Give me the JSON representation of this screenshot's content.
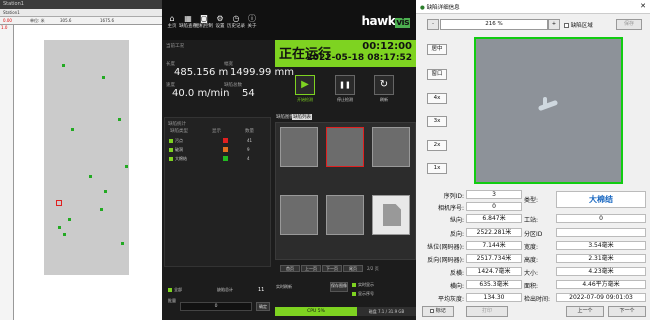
{
  "map": {
    "window_title": "Station1",
    "tab": "Station1",
    "header_cols": [
      "0.00",
      "单位: 米",
      "305.6",
      "1675.6"
    ],
    "ruler_marks": [
      "0.0",
      "",
      "",
      "",
      ""
    ],
    "y_labels": [
      "1.0",
      "",
      "",
      "",
      "",
      "",
      "",
      "",
      ""
    ]
  },
  "nav": {
    "items": [
      {
        "label": "主页",
        "icon": "home-icon",
        "glyph": "⌂"
      },
      {
        "label": "缺陷查看",
        "icon": "grid-icon",
        "glyph": "▦"
      },
      {
        "label": "相机控制",
        "icon": "camera-icon",
        "glyph": "◙"
      },
      {
        "label": "设置",
        "icon": "gear-icon",
        "glyph": "⚙"
      },
      {
        "label": "历史记录",
        "icon": "clock-icon",
        "glyph": "◷"
      },
      {
        "label": "关于",
        "icon": "info-icon",
        "glyph": "ⓘ"
      }
    ],
    "logo_main": "hawk",
    "logo_tag": "vis"
  },
  "info": {
    "section": "当前工况",
    "length_label": "长度",
    "length": "485.156 m",
    "width_label": "幅宽",
    "width": "1499.99 mm",
    "speed_label": "速度",
    "speed": "40.0 m/min",
    "defects_label": "缺陷总数",
    "defects": "54"
  },
  "status": {
    "title": "正在运行",
    "elapsed": "00:12:00",
    "datetime": "2022-05-18 08:17:52"
  },
  "controls": [
    {
      "label": "开始检测",
      "glyph": "▶",
      "icon": "play-icon"
    },
    {
      "label": "停止检测",
      "glyph": "❚❚",
      "icon": "pause-icon"
    },
    {
      "label": "刷新",
      "glyph": "↻",
      "icon": "refresh-icon"
    }
  ],
  "stats": {
    "title": "缺陷统计",
    "headers": [
      "缺陷类型",
      "显示",
      "数量"
    ],
    "rows": [
      {
        "name": "污点",
        "count": "41"
      },
      {
        "name": "破洞",
        "count": "9"
      },
      {
        "name": "大棉结",
        "count": "4"
      }
    ],
    "show_all": "全部",
    "total_label": "缺陷总计",
    "total": "11",
    "name_label": "批量",
    "name_value": "0",
    "confirm": "确定"
  },
  "thumbs": {
    "tabs": [
      "缺陷图像",
      "缺陷列表"
    ],
    "paging": [
      "首页",
      "上一页",
      "下一页",
      "尾页"
    ],
    "page": "2/2 页",
    "auto_refresh": "实时刷新",
    "keep": "保存图像",
    "options": [
      "实时显示",
      "显示序号"
    ],
    "cpu": "CPU 5%",
    "disk": "磁盘 7.1 / 31.9 GB"
  },
  "dialog": {
    "title": "缺陷详细信息",
    "zoom_minus": "-",
    "zoom": "216 %",
    "zoom_plus": "+",
    "area_check": "缺陷区域",
    "save": "保存",
    "zoom_buttons": [
      "居中",
      "窗口",
      "4x",
      "3x",
      "2x",
      "1x"
    ],
    "fields_left": [
      {
        "label": "序列ID:",
        "value": "3"
      },
      {
        "label": "相机序号:",
        "value": "0"
      },
      {
        "label": "纵向:",
        "value": "6.847米"
      },
      {
        "label": "反向:",
        "value": "2522.281米"
      },
      {
        "label": "纵位(网码器):",
        "value": "7.144米"
      },
      {
        "label": "反向(网码器):",
        "value": "2517.734米"
      },
      {
        "label": "反横:",
        "value": "1424.7毫米"
      },
      {
        "label": "横向:",
        "value": "635.3毫米"
      },
      {
        "label": "平均灰度:",
        "value": "134.30"
      }
    ],
    "type_label": "类型:",
    "type_value": "大棉结",
    "fields_right": [
      {
        "label": "工站:",
        "value": "0"
      },
      {
        "label": "分区ID",
        "value": ""
      },
      {
        "label": "宽度:",
        "value": "3.54毫米"
      },
      {
        "label": "高度:",
        "value": "2.31毫米"
      },
      {
        "label": "大小:",
        "value": "4.23毫米"
      },
      {
        "label": "面积:",
        "value": "4.46平方毫米"
      },
      {
        "label": "检出时间:",
        "value": "2022-07-09 09:01:03"
      }
    ],
    "mark": "标记",
    "print": "打印",
    "prev": "上一个",
    "next": "下一个"
  }
}
